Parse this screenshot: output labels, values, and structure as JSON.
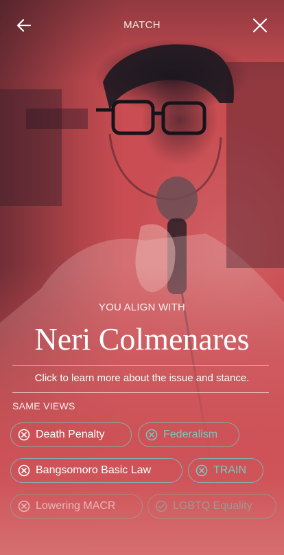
{
  "header": {
    "title": "MATCH",
    "back_icon": "arrow-left-icon",
    "close_icon": "close-icon"
  },
  "result": {
    "align_label": "YOU ALIGN WITH",
    "candidate_name": "Neri Colmenares",
    "learn_more": "Click to learn more about the issue and stance."
  },
  "same_views": {
    "label": "SAME VIEWS",
    "chips": [
      {
        "label": "Death Penalty",
        "icon": "x-circle-icon"
      },
      {
        "label": "Federalism",
        "icon": "x-circle-icon"
      },
      {
        "label": "Bangsomoro Basic Law",
        "icon": "x-circle-icon"
      },
      {
        "label": "TRAIN",
        "icon": "x-circle-icon"
      },
      {
        "label": "Lowering MACR",
        "icon": "x-circle-icon"
      },
      {
        "label": "LGBTQ Equality",
        "icon": "check-circle-icon"
      }
    ]
  },
  "colors": {
    "background": "#c84a4f",
    "chip_border": "#7cc5bf",
    "text": "#ffffff"
  }
}
